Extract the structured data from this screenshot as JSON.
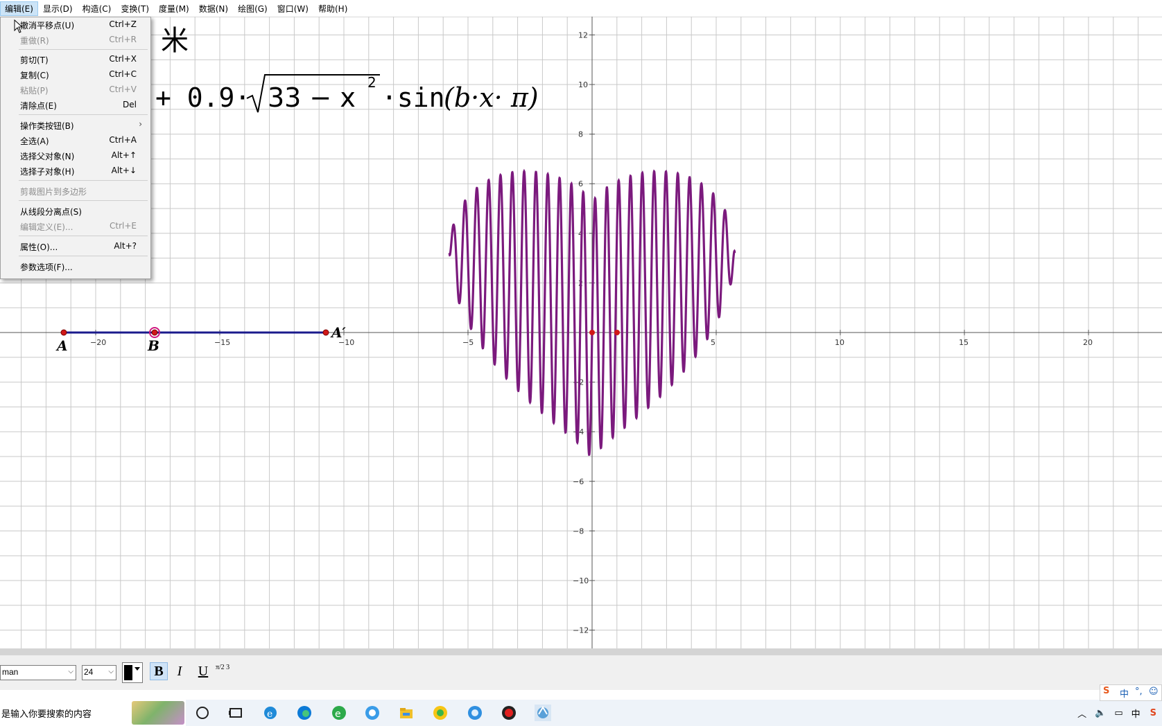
{
  "menubar": {
    "items": [
      "编辑(E)",
      "显示(D)",
      "构造(C)",
      "变换(T)",
      "度量(M)",
      "数据(N)",
      "绘图(G)",
      "窗口(W)",
      "帮助(H)"
    ]
  },
  "edit_menu": {
    "undo": {
      "label": "撤消平移点(U)",
      "shortcut": "Ctrl+Z"
    },
    "redo": {
      "label": "重做(R)",
      "shortcut": "Ctrl+R"
    },
    "cut": {
      "label": "剪切(T)",
      "shortcut": "Ctrl+X"
    },
    "copy": {
      "label": "复制(C)",
      "shortcut": "Ctrl+C"
    },
    "paste": {
      "label": "粘贴(P)",
      "shortcut": "Ctrl+V"
    },
    "clear": {
      "label": "清除点(E)",
      "shortcut": "Del"
    },
    "action_buttons": {
      "label": "操作类按钮(B)",
      "arrow": "›"
    },
    "select_all": {
      "label": "全选(A)",
      "shortcut": "Ctrl+A"
    },
    "select_parents": {
      "label": "选择父对象(N)",
      "shortcut": "Alt+↑"
    },
    "select_children": {
      "label": "选择子对象(H)",
      "shortcut": "Alt+↓"
    },
    "crop_picture": {
      "label": "剪裁图片到多边形"
    },
    "split_point": {
      "label": "从线段分离点(S)"
    },
    "edit_definition": {
      "label": "编辑定义(E)...",
      "shortcut": "Ctrl+E"
    },
    "properties": {
      "label": "属性(O)...",
      "shortcut": "Alt+?"
    },
    "preferences": {
      "label": "参数选项(F)..."
    }
  },
  "canvas": {
    "title_fragment": "米",
    "formula": {
      "prefix": "+ 0.9·",
      "radicand": "33 − x",
      "exponent": "2",
      "sin": "·sin",
      "args": "(b·x· π)"
    },
    "points": {
      "A": "A",
      "B": "B",
      "A_prime": "A′"
    },
    "x_ticks": [
      -20,
      -15,
      -10,
      -5,
      5,
      10,
      15,
      20
    ],
    "y_ticks": [
      12,
      10,
      8,
      6,
      4,
      2,
      -2,
      -4,
      -6,
      -8,
      -10,
      -12
    ],
    "curve_color": "#7b1a7d",
    "segment_color": "#1a1a8c",
    "point_color": "#d01818",
    "grid_color": "#c8c8c8"
  },
  "text_toolbar": {
    "font": "man",
    "size": "24",
    "bold": "B",
    "italic": "I",
    "underline": "U",
    "math_format": "π/2 3"
  },
  "taskbar": {
    "search_placeholder": "是输入你要搜索的内容",
    "ime_label": "中"
  }
}
